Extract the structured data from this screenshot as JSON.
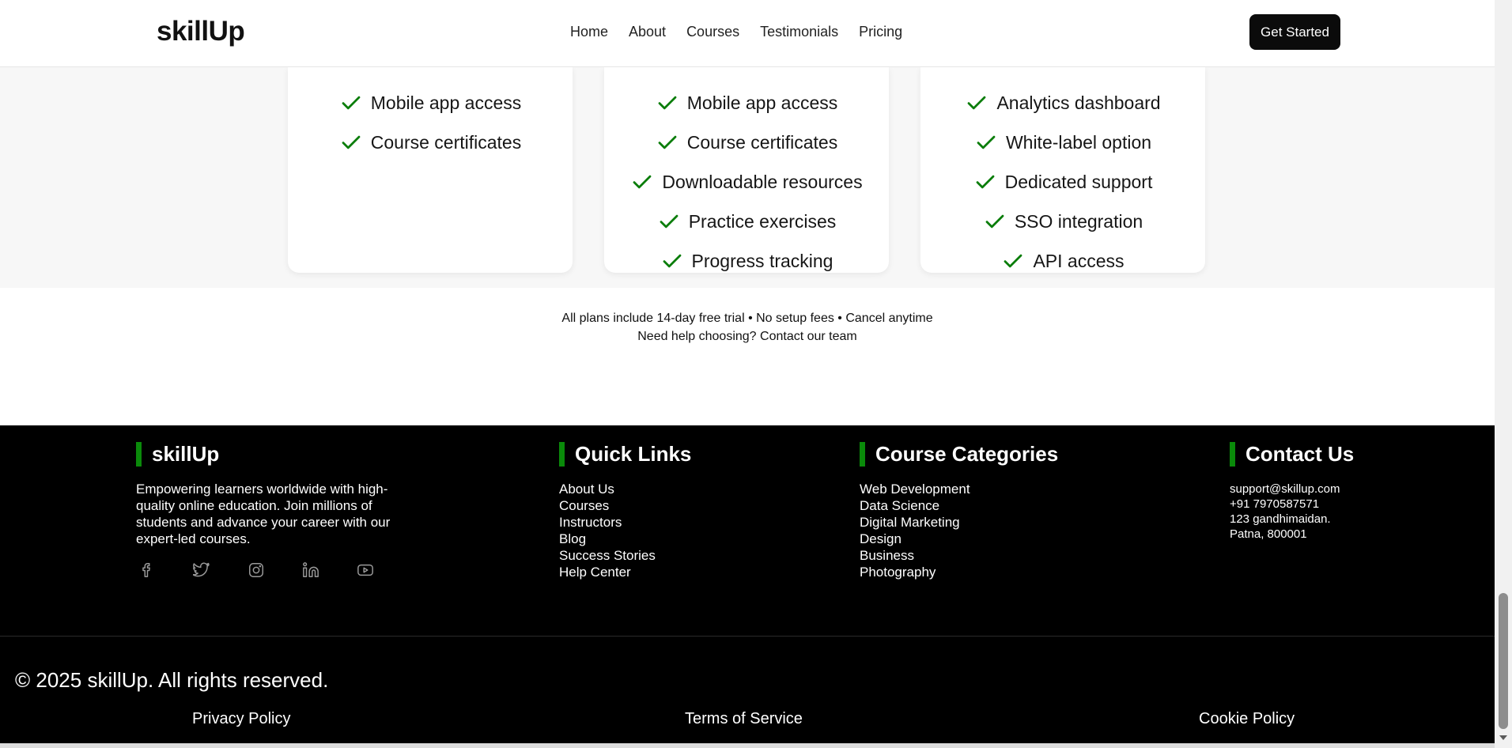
{
  "header": {
    "logo": "skillUp",
    "nav": [
      "Home",
      "About",
      "Courses",
      "Testimonials",
      "Pricing"
    ],
    "cta": "Get Started"
  },
  "pricing": {
    "accent_color": "#0a7d0a",
    "cards": [
      {
        "features": [
          "Mobile app access",
          "Course certificates"
        ]
      },
      {
        "features": [
          "Mobile app access",
          "Course certificates",
          "Downloadable resources",
          "Practice exercises",
          "Progress tracking"
        ]
      },
      {
        "features": [
          "Analytics dashboard",
          "White-label option",
          "Dedicated support",
          "SSO integration",
          "API access"
        ]
      }
    ],
    "note_line1": "All plans include 14-day free trial • No setup fees • Cancel anytime",
    "note_line2": "Need help choosing? Contact our team"
  },
  "footer": {
    "brand": {
      "title": "skillUp",
      "description": "Empowering learners worldwide with high-quality online education. Join millions of students and advance your career with our expert-led courses.",
      "social_icons": [
        "facebook-icon",
        "twitter-icon",
        "instagram-icon",
        "linkedin-icon",
        "youtube-icon"
      ]
    },
    "quick_links": {
      "title": "Quick Links",
      "items": [
        "About Us",
        "Courses",
        "Instructors",
        "Blog",
        "Success Stories",
        "Help Center"
      ]
    },
    "categories": {
      "title": "Course Categories",
      "items": [
        "Web Development",
        "Data Science",
        "Digital Marketing",
        "Design",
        "Business",
        "Photography"
      ]
    },
    "contact": {
      "title": "Contact Us",
      "email": "support@skillup.com",
      "phone": "+91 7970587571",
      "address_line1": "123 gandhimaidan.",
      "address_line2": "Patna, 800001"
    },
    "copyright": "© 2025 skillUp. All rights reserved.",
    "legal": [
      "Privacy Policy",
      "Terms of Service",
      "Cookie Policy"
    ],
    "accent_color": "#0a8a0a"
  }
}
